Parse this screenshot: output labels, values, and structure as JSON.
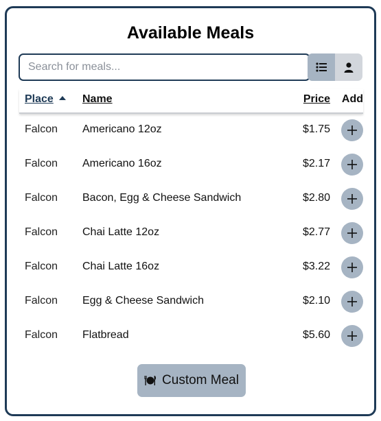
{
  "title": "Available Meals",
  "search": {
    "placeholder": "Search for meals...",
    "value": ""
  },
  "view_toggle": {
    "list_icon": "list-icon",
    "person_icon": "person-icon",
    "active": "list"
  },
  "table": {
    "headers": {
      "place": "Place",
      "name": "Name",
      "price": "Price",
      "add": "Add"
    },
    "sort": {
      "column": "place",
      "direction": "ascending"
    },
    "rows": [
      {
        "place": "Falcon",
        "name": "Americano 12oz",
        "price": "$1.75"
      },
      {
        "place": "Falcon",
        "name": "Americano 16oz",
        "price": "$2.17"
      },
      {
        "place": "Falcon",
        "name": "Bacon, Egg & Cheese Sandwich",
        "price": "$2.80"
      },
      {
        "place": "Falcon",
        "name": "Chai Latte 12oz",
        "price": "$2.77"
      },
      {
        "place": "Falcon",
        "name": "Chai Latte 16oz",
        "price": "$3.22"
      },
      {
        "place": "Falcon",
        "name": "Egg & Cheese Sandwich",
        "price": "$2.10"
      },
      {
        "place": "Falcon",
        "name": "Flatbread",
        "price": "$5.60"
      }
    ]
  },
  "custom_meal_button": {
    "label": "Custom Meal",
    "icon": "dining-icon"
  },
  "colors": {
    "accent": "#1e3a56",
    "button_bg": "#a6b4c3",
    "toggle_bg": "#d2d6dc"
  }
}
